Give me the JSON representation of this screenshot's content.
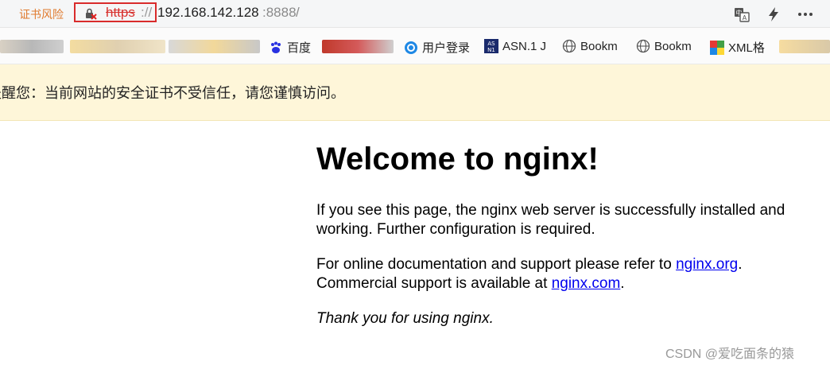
{
  "address_bar": {
    "cert_warning": "证书风险",
    "protocol": "https",
    "separator": "://",
    "host": "192.168.142.128",
    "port": ":8888",
    "path": "/"
  },
  "bookmarks": [
    {
      "label": "百度",
      "icon": "baidu-paw-icon"
    },
    {
      "label": "用户登录",
      "icon": "circle-e-icon"
    },
    {
      "label": "ASN.1 J",
      "icon": "asn-logo-icon"
    },
    {
      "label": "Bookm",
      "icon": "globe-icon"
    },
    {
      "label": "Bookm",
      "icon": "globe-icon"
    },
    {
      "label": "XML格",
      "icon": "xml-puzzle-icon"
    }
  ],
  "banner": {
    "text": "提醒您：当前网站的安全证书不受信任，请您谨慎访问。"
  },
  "page": {
    "heading": "Welcome to nginx!",
    "p1": "If you see this page, the nginx web server is successfully installed and working. Further configuration is required.",
    "p2_prefix": "For online documentation and support please refer to ",
    "p2_link1": "nginx.org",
    "p2_mid": ".",
    "p2_line2_prefix": "Commercial support is available at ",
    "p2_link2": "nginx.com",
    "p2_end": ".",
    "p3": "Thank you for using nginx."
  },
  "watermark": "CSDN @爱吃面条的猿",
  "colors": {
    "cert_warning": "#e07a2e",
    "insecure_protocol": "#d8322f",
    "banner_bg": "#fef6d9",
    "link": "#0000ee"
  }
}
